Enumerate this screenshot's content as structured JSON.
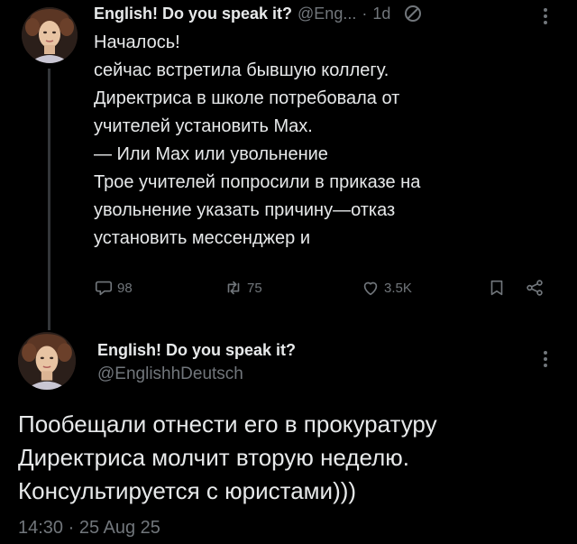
{
  "tweet1": {
    "display_name": "English! Do you speak it?",
    "handle": "@Eng...",
    "separator": "·",
    "age": "1d",
    "lines": [
      "Началось!",
      "сейчас встретила бывшую коллегу.",
      "Директриса в школе потребовала от",
      "учителей установить Max.",
      "— Или Max или увольнение",
      "Трое учителей попросили в приказе на",
      "увольнение указать причину—отказ",
      "установить мессенджер и"
    ],
    "actions": {
      "replies": "98",
      "retweets": "75",
      "likes": "3.5K"
    }
  },
  "tweet2": {
    "display_name": "English! Do you speak it?",
    "handle": "@EnglishhDeutsch",
    "lines": [
      "Пообещали отнести его в прокуратуру",
      "Директриса молчит вторую неделю.",
      "Консультируется с юристами)))"
    ],
    "timestamp": "14:30 · 25 Aug 25"
  },
  "icons": {
    "reply": "speech-bubble-icon",
    "retweet": "retweet-icon",
    "like": "heart-icon",
    "bookmark": "bookmark-icon",
    "share": "share-icon",
    "more": "vertical-dots-icon",
    "muted": "no-entry-icon"
  },
  "colors": {
    "background": "#000000",
    "text": "#e7e9ea",
    "muted": "#71767b",
    "thread_line": "#333639"
  }
}
